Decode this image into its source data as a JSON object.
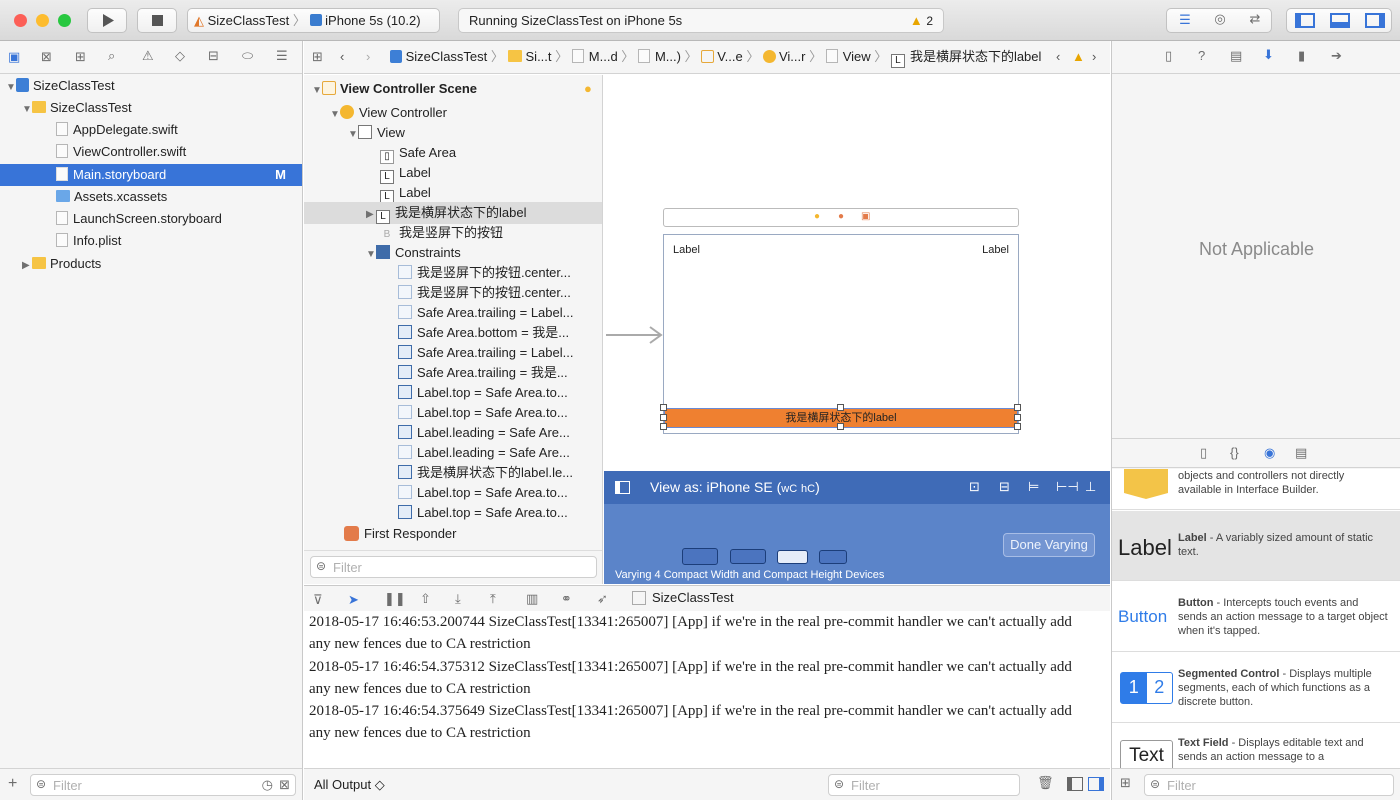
{
  "toolbar": {
    "scheme": "SizeClassTest",
    "device": "iPhone 5s (10.2)",
    "status": "Running SizeClassTest on iPhone 5s",
    "warning_count": "2"
  },
  "navigator": {
    "items": [
      {
        "label": "SizeClassTest",
        "badge": ""
      },
      {
        "label": "SizeClassTest",
        "badge": ""
      },
      {
        "label": "AppDelegate.swift",
        "badge": ""
      },
      {
        "label": "ViewController.swift",
        "badge": ""
      },
      {
        "label": "Main.storyboard",
        "badge": "M"
      },
      {
        "label": "Assets.xcassets",
        "badge": ""
      },
      {
        "label": "LaunchScreen.storyboard",
        "badge": ""
      },
      {
        "label": "Info.plist",
        "badge": ""
      },
      {
        "label": "Products",
        "badge": ""
      }
    ],
    "filter_placeholder": "Filter"
  },
  "jumpbar": {
    "crumbs": [
      "SizeClassTest",
      "Si...t",
      "M...d",
      "M...)",
      "V...e",
      "Vi...r",
      "View",
      "我是横屏状态下的label"
    ]
  },
  "outline": {
    "items": [
      "View Controller Scene",
      "View Controller",
      "View",
      "Safe Area",
      "Label",
      "Label",
      "我是横屏状态下的label",
      "我是竖屏下的按钮",
      "Constraints",
      "我是竖屏下的按钮.center...",
      "我是竖屏下的按钮.center...",
      "Safe Area.trailing = Label...",
      "Safe Area.bottom = 我是...",
      "Safe Area.trailing = Label...",
      "Safe Area.trailing = 我是...",
      "Label.top = Safe Area.to...",
      "Label.top = Safe Area.to...",
      "Label.leading = Safe Are...",
      "Label.leading = Safe Are...",
      "我是横屏状态下的label.le...",
      "Label.top = Safe Area.to...",
      "Label.top = Safe Area.to...",
      "First Responder"
    ],
    "filter_placeholder": "Filter"
  },
  "canvas": {
    "label_left": "Label",
    "label_right": "Label",
    "orange_label": "我是横屏状态下的label"
  },
  "varybar": {
    "view_as": "View as: iPhone SE (",
    "size_w": "wC",
    "size_h": "hC",
    "paren_close": ")",
    "done": "Done Varying",
    "caption": "Varying 4 Compact Width and Compact Height Devices"
  },
  "debug": {
    "target": "SizeClassTest",
    "lines": [
      "2018-05-17 16:46:53.200744 SizeClassTest[13341:265007] [App] if we're in the real pre-commit handler we can't actually add",
      "any new fences due to CA restriction",
      "2018-05-17 16:46:54.375312 SizeClassTest[13341:265007] [App] if we're in the real pre-commit handler we can't actually add",
      "any new fences due to CA restriction",
      "2018-05-17 16:46:54.375649 SizeClassTest[13341:265007] [App] if we're in the real pre-commit handler we can't actually add",
      "any new fences due to CA restriction"
    ],
    "output_select": "All Output ◇",
    "filter_placeholder": "Filter"
  },
  "inspector": {
    "not_applicable": "Not Applicable"
  },
  "library": {
    "partial_desc": "objects and controllers not directly available in Interface Builder.",
    "items": [
      {
        "preview": "Label",
        "title": "Label",
        "desc": " - A variably sized amount of static text."
      },
      {
        "preview": "Button",
        "title": "Button",
        "desc": " - Intercepts touch events and sends an action message to a target object when it's tapped."
      },
      {
        "preview": "",
        "title": "Segmented Control",
        "desc": " - Displays multiple segments, each of which functions as a discrete button."
      },
      {
        "preview": "Text",
        "title": "Text Field",
        "desc": " - Displays editable text and sends an action message to a"
      }
    ],
    "segments": [
      "1",
      "2"
    ],
    "filter_placeholder": "Filter"
  },
  "colors": {
    "accent": "#3874d8",
    "orange": "#ef8030",
    "vary_bar": "#3f6bb7"
  }
}
